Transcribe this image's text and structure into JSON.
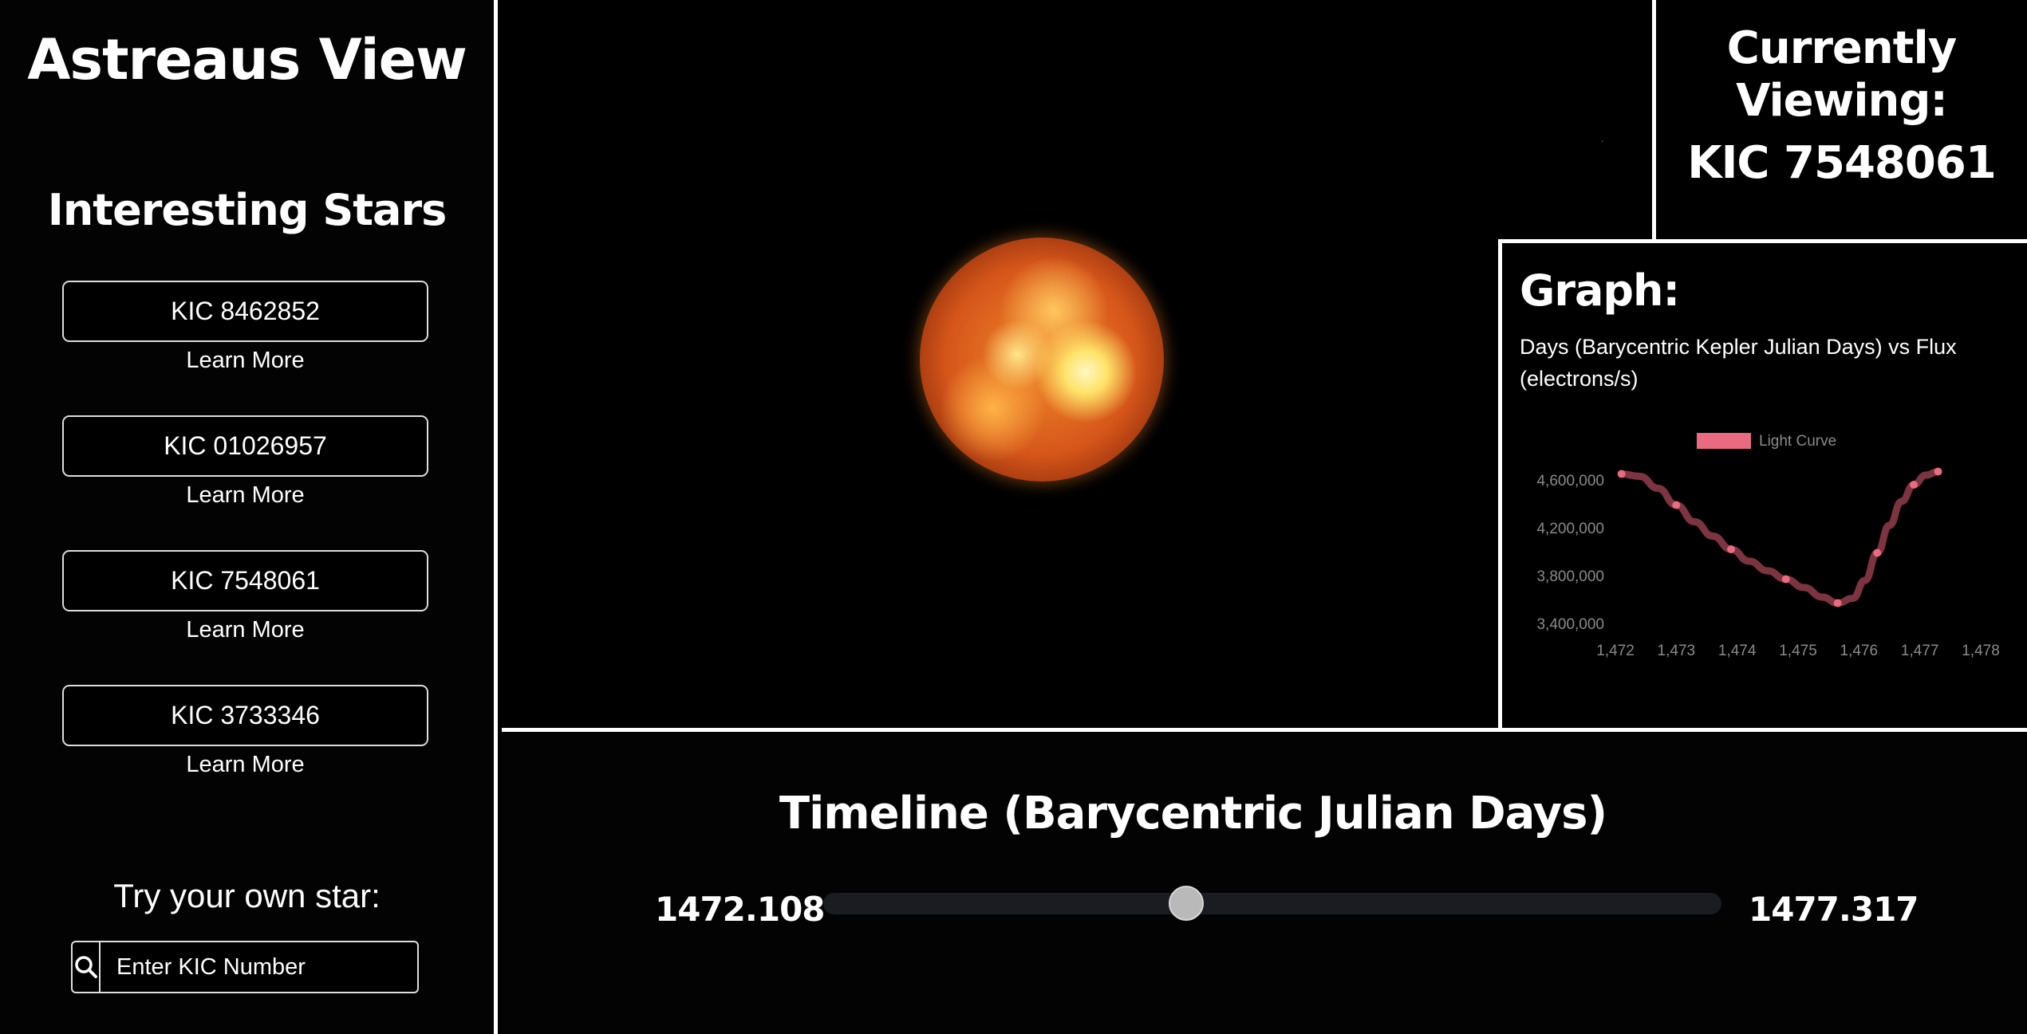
{
  "app": {
    "title": "Astreaus View"
  },
  "sidebar": {
    "section_title": "Interesting Stars",
    "stars": [
      {
        "label": "KIC 8462852",
        "link": "Learn More"
      },
      {
        "label": "KIC 01026957",
        "link": "Learn More"
      },
      {
        "label": "KIC 7548061",
        "link": "Learn More"
      },
      {
        "label": "KIC 3733346",
        "link": "Learn More"
      }
    ],
    "custom": {
      "label": "Try your own star:",
      "placeholder": "Enter KIC Number",
      "icon": "search-icon"
    }
  },
  "current": {
    "label": "Currently Viewing:",
    "value": "KIC 7548061"
  },
  "graph": {
    "title": "Graph:",
    "subtitle": "Days (Barycentric Kepler Julian Days) vs Flux (electrons/s)"
  },
  "chart_data": {
    "type": "line",
    "title": "",
    "xlabel": "",
    "ylabel": "",
    "series": [
      {
        "name": "Light Curve",
        "x": [
          1472.1,
          1472.4,
          1472.7,
          1473.0,
          1473.3,
          1473.6,
          1473.9,
          1474.2,
          1474.5,
          1474.8,
          1475.1,
          1475.4,
          1475.65,
          1475.9,
          1476.1,
          1476.3,
          1476.5,
          1476.7,
          1476.9,
          1477.1,
          1477.3
        ],
        "y": [
          4650000,
          4630000,
          4530000,
          4390000,
          4250000,
          4130000,
          4020000,
          3920000,
          3840000,
          3770000,
          3700000,
          3620000,
          3570000,
          3610000,
          3760000,
          3990000,
          4220000,
          4420000,
          4560000,
          4640000,
          4670000
        ]
      }
    ],
    "xticks": [
      "1,472",
      "1,473",
      "1,474",
      "1,475",
      "1,476",
      "1,477",
      "1,478"
    ],
    "yticks": [
      "4,600,000",
      "4,200,000",
      "3,800,000",
      "3,400,000"
    ],
    "xlim": [
      1472,
      1478
    ],
    "ylim": [
      3400000,
      4600000
    ],
    "legend": "top-center",
    "line_color": "#8a3a48",
    "legend_color": "#ea6a80",
    "grid": false
  },
  "timeline": {
    "title": "Timeline (Barycentric Julian Days)",
    "min": "1472.108",
    "max": "1477.317",
    "value_fraction": 0.4
  }
}
